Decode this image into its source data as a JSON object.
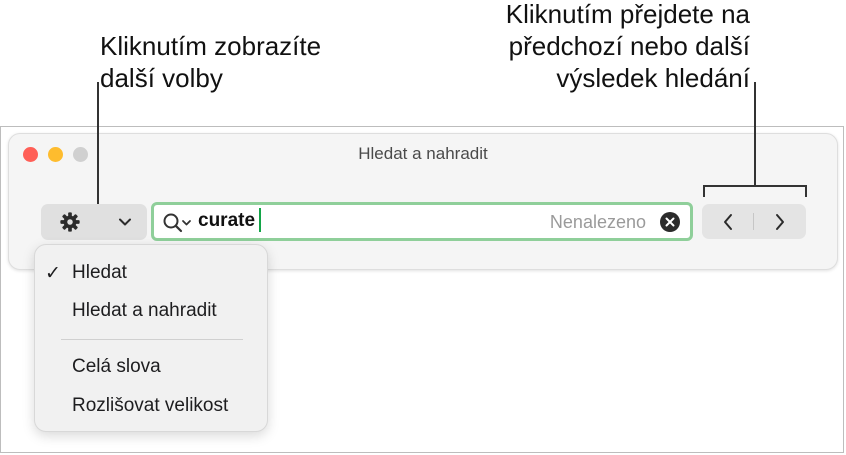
{
  "callouts": {
    "left_line1": "Kliknutím zobrazíte",
    "left_line2": "další volby",
    "right_line1": "Kliknutím přejdete na",
    "right_line2": "předchozí nebo další",
    "right_line3": "výsledek hledání"
  },
  "window": {
    "title": "Hledat a nahradit",
    "traffic_lights": {
      "close": "#ff5f57",
      "minimize": "#febc2e",
      "zoom": "#d0d0d0"
    }
  },
  "toolbar": {
    "options_icon": "gear-icon",
    "options_chevron_icon": "chevron-down-icon",
    "search": {
      "icon": "magnifier-dropdown-icon",
      "value": "curate",
      "status": "Nenalezeno",
      "clear_icon": "clear-icon",
      "focus_color": "#8fcf9a"
    },
    "nav": {
      "previous_icon": "chevron-left-icon",
      "next_icon": "chevron-right-icon"
    }
  },
  "menu": {
    "items": [
      {
        "label": "Hledat",
        "checked": true
      },
      {
        "label": "Hledat a nahradit",
        "checked": false
      },
      {
        "label": "Celá slova",
        "checked": false
      },
      {
        "label": "Rozlišovat velikost",
        "checked": false
      }
    ],
    "check_mark": "✓"
  }
}
